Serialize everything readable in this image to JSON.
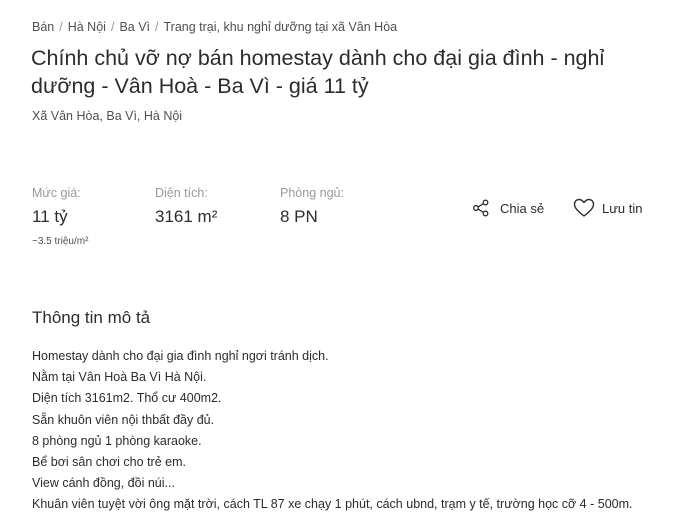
{
  "breadcrumb": [
    "Bán",
    "Hà Nội",
    "Ba Vì",
    "Trang trại, khu nghỉ dưỡng tại xã Vân Hòa"
  ],
  "title": "Chính chủ vỡ nợ bán homestay dành cho đại gia đình - nghỉ dưỡng - Vân Hoà - Ba Vì - giá 11 tỷ",
  "address": "Xã Vân Hòa, Ba Vì, Hà Nội",
  "stats": {
    "price": {
      "label": "Mức giá:",
      "value": "11 tỷ",
      "sub": "~3.5 triệu/m²"
    },
    "area": {
      "label": "Diện tích:",
      "value": "3161 m²"
    },
    "bedrooms": {
      "label": "Phòng ngủ:",
      "value": "8 PN"
    }
  },
  "actions": {
    "share": "Chia sẻ",
    "save": "Lưu tin"
  },
  "icons": {
    "share": "share-icon",
    "save": "heart-icon"
  },
  "section": {
    "title": "Thông tin mô tả"
  },
  "description": [
    "Homestay dành cho đại gia đình nghỉ ngơi tránh dịch.",
    "Nằm tại Vân Hoà Ba Vì Hà Nội.",
    "Diện tích 3161m2. Thổ cư 400m2.",
    "Sẵn khuôn viên nội thbất đầy đủ.",
    "8 phòng ngủ 1 phòng karaoke.",
    "Bể bơi sân chơi cho trẻ em.",
    "View cánh đồng, đồi núi...",
    "Khuân viên tuyệt vời ông mặt trời, cách TL 87 xe chạy 1 phút, cách ubnd, trạm y tế, trường học cỡ 4 - 500m."
  ]
}
